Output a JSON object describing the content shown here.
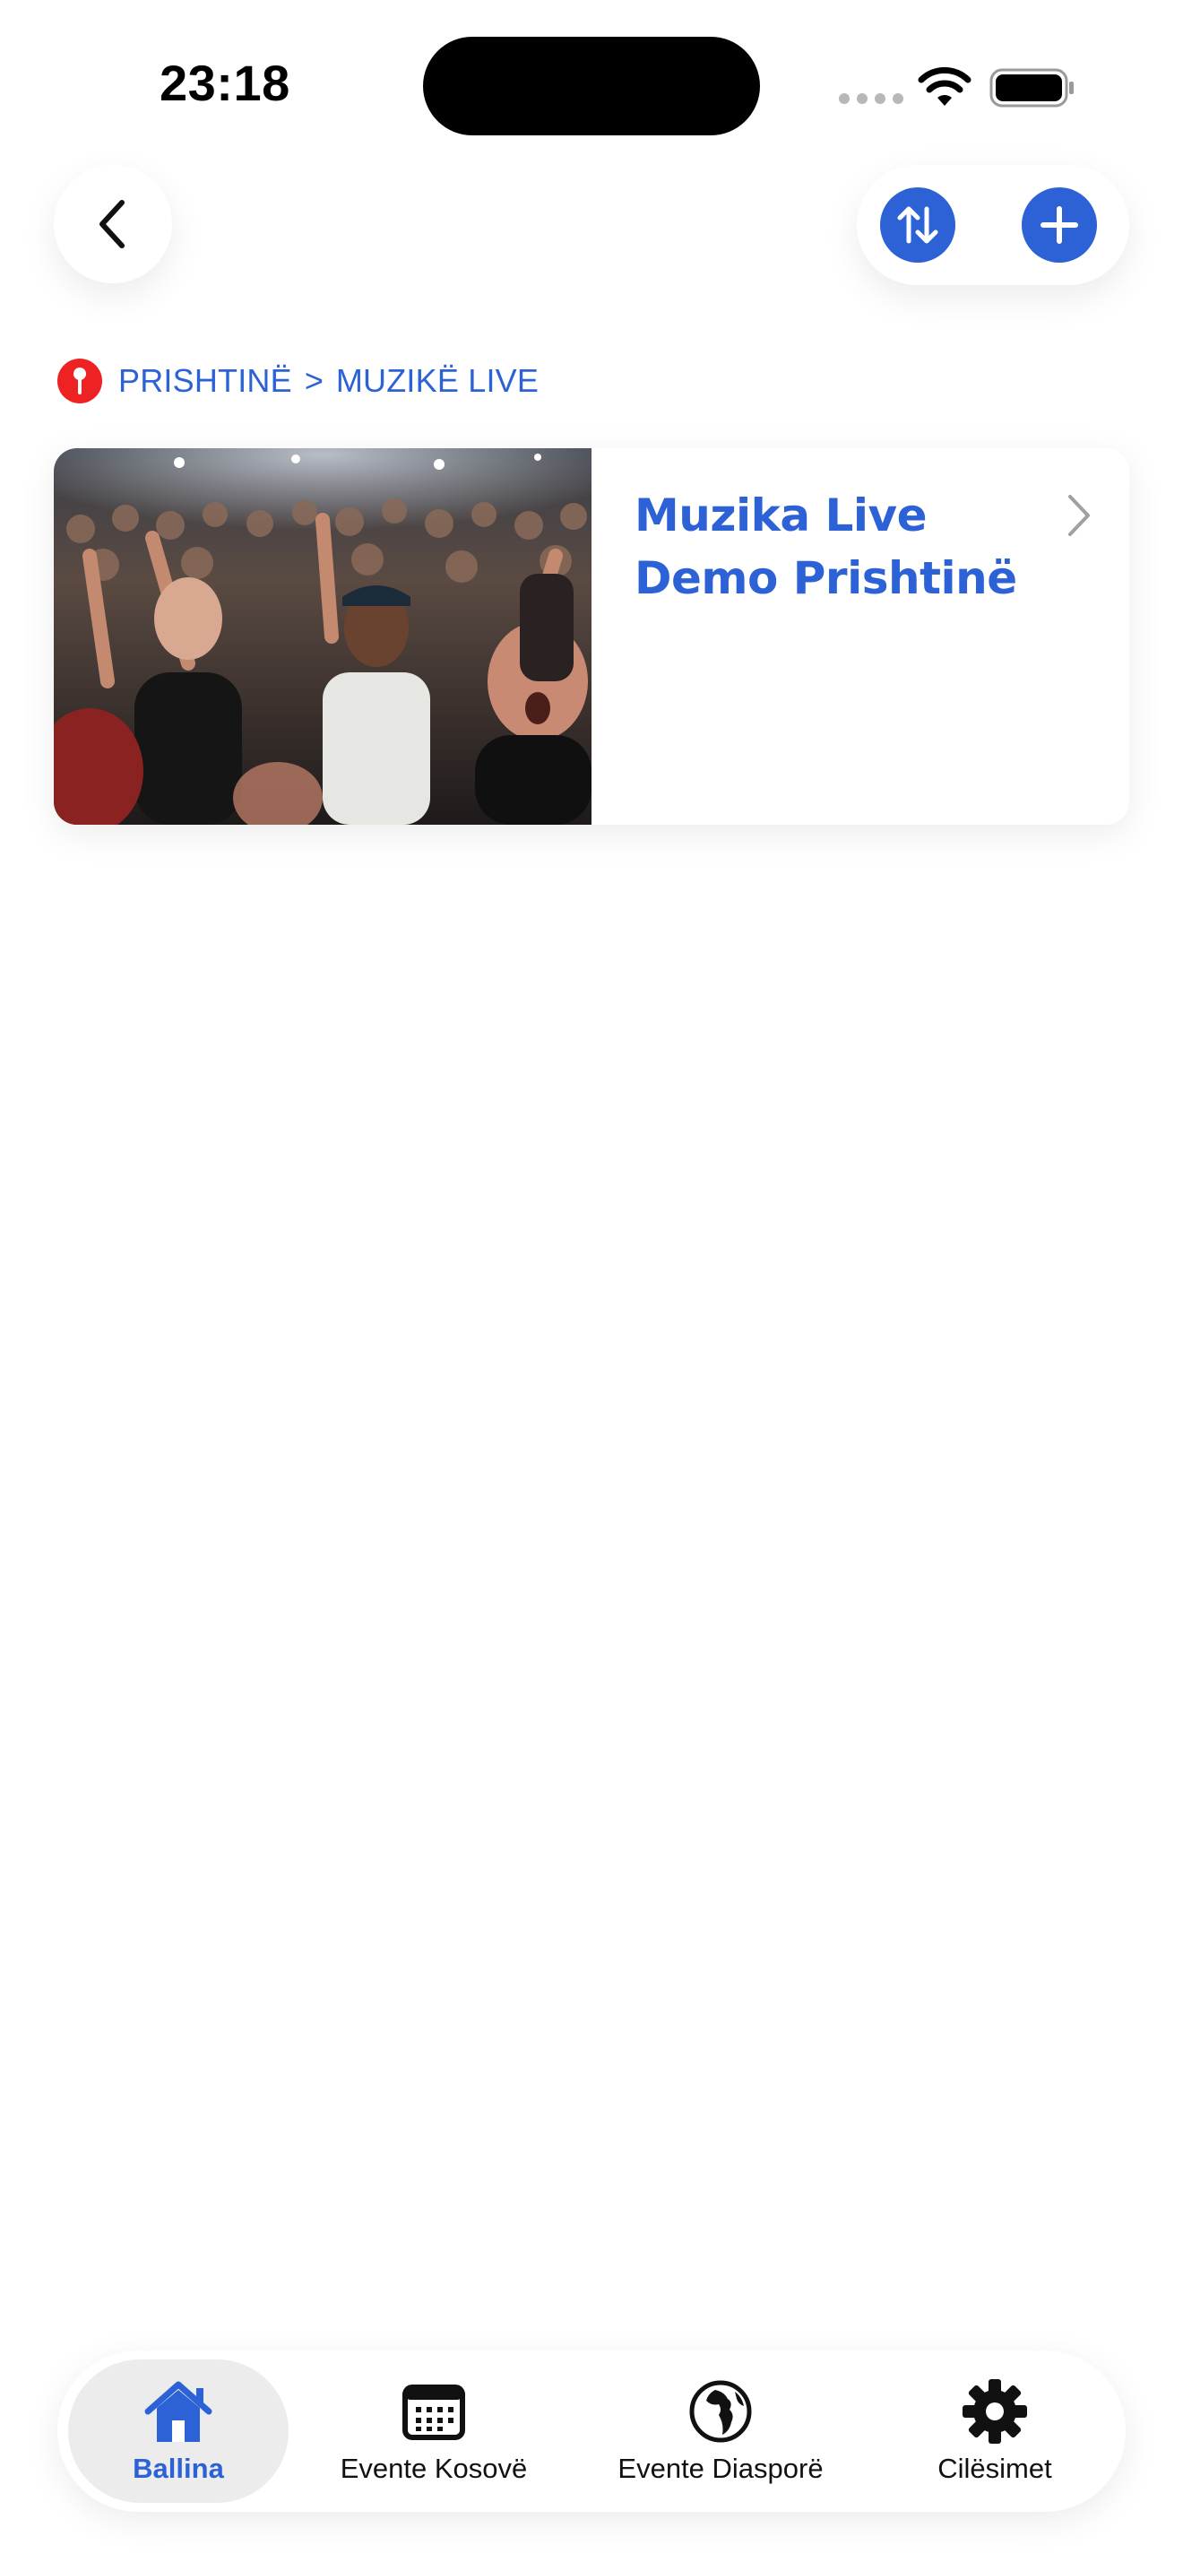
{
  "status_bar": {
    "time": "23:18"
  },
  "header": {
    "back_icon": "chevron-left-icon",
    "actions": [
      {
        "name": "sort",
        "icon": "sort-arrows-icon"
      },
      {
        "name": "add",
        "icon": "plus-icon"
      }
    ]
  },
  "breadcrumb": {
    "icon": "map-pin-icon",
    "city": "PRISHTINË",
    "separator": ">",
    "category": "MUZIKË LIVE"
  },
  "events": [
    {
      "title_line1": "Muzika Live",
      "title_line2": "Demo Prishtinë",
      "image": "concert-crowd-photo",
      "chevron": "chevron-right-icon"
    }
  ],
  "tabs": [
    {
      "label": "Ballina",
      "icon": "home-icon",
      "active": true
    },
    {
      "label": "Evente Kosovë",
      "icon": "calendar-icon",
      "active": false
    },
    {
      "label": "Evente Diasporë",
      "icon": "globe-icon",
      "active": false
    },
    {
      "label": "Cilësimet",
      "icon": "gear-icon",
      "active": false
    }
  ],
  "colors": {
    "accent": "#2c62d6",
    "pin": "#ee2222",
    "background": "#ffffff",
    "tab_active_bg": "#ececec"
  }
}
